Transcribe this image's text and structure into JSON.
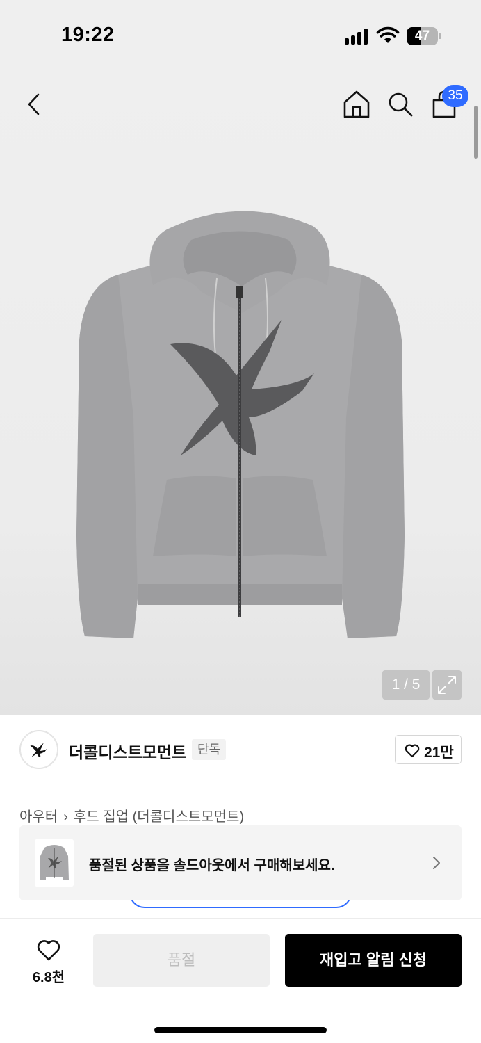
{
  "status_bar": {
    "time": "19:22",
    "battery_level": "47",
    "battery_fraction": 0.47
  },
  "header": {
    "cart_badge": "35"
  },
  "gallery": {
    "current": "1",
    "total": "5",
    "pager_text": "1 / 5"
  },
  "brand": {
    "name": "더콜디스트모먼트",
    "tag": "단독",
    "likes": "21만"
  },
  "breadcrumb": {
    "category": "아우터",
    "subcategory": "후드 집업 (더콜디스트모먼트)"
  },
  "banner": {
    "text": "품절된 상품을 솔드아웃에서 구매해보세요."
  },
  "bottom_bar": {
    "wish_count": "6.8천",
    "soldout_label": "품절",
    "restock_label": "재입고 알림 신청"
  },
  "colors": {
    "accent": "#2f6bff",
    "primary_button": "#000000",
    "disabled_button": "#efefef"
  },
  "icons": [
    "back-icon",
    "home-icon",
    "search-icon",
    "cart-icon",
    "expand-icon",
    "heart-icon",
    "chevron-right-icon"
  ]
}
